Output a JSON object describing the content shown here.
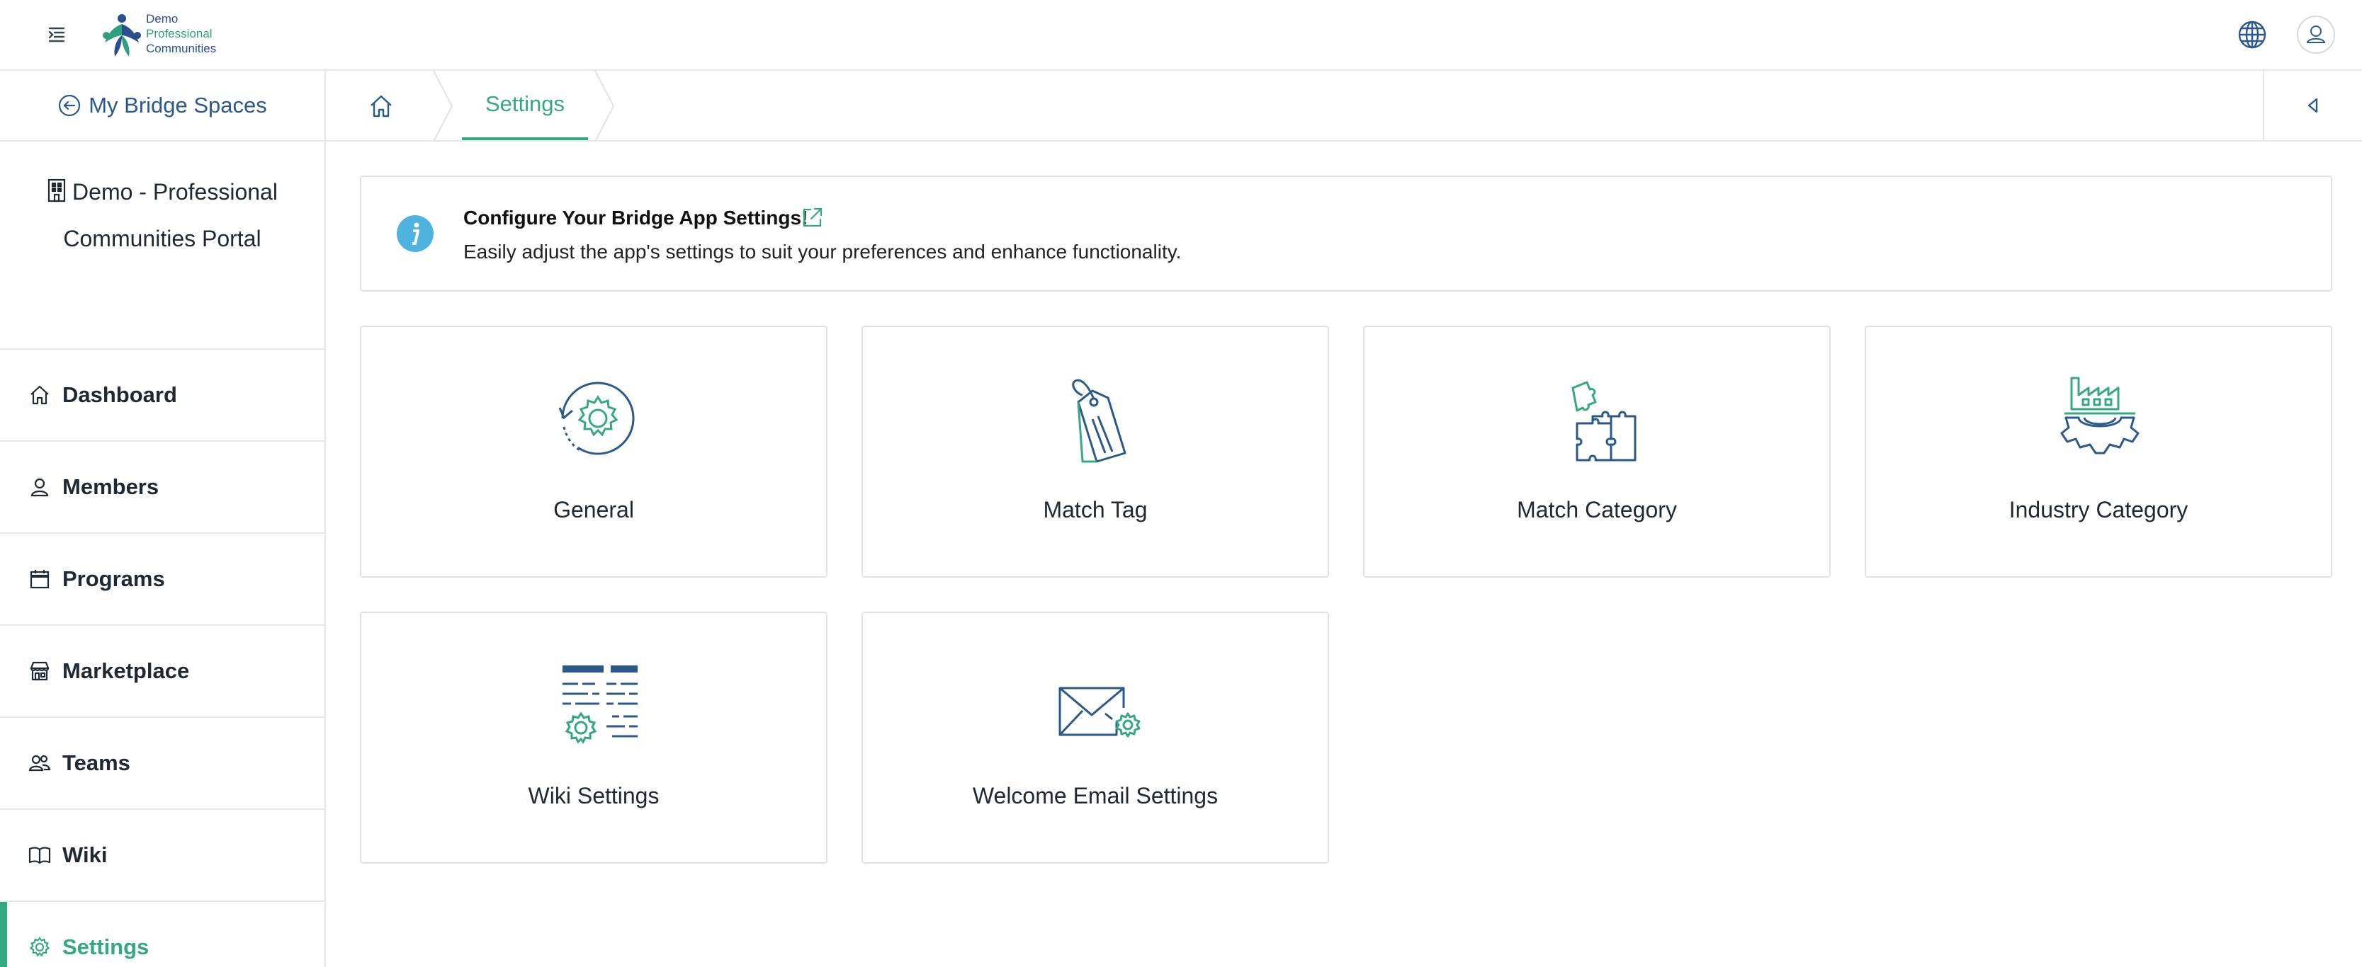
{
  "header": {
    "logo": {
      "line1": "Demo",
      "line2": "Professional",
      "line3": "Communities"
    }
  },
  "sidebar": {
    "back_label": "My Bridge Spaces",
    "portal_line1": "Demo - Professional",
    "portal_line2": "Communities Portal",
    "items": [
      {
        "label": "Dashboard",
        "icon": "home-icon"
      },
      {
        "label": "Members",
        "icon": "user-icon"
      },
      {
        "label": "Programs",
        "icon": "calendar-icon"
      },
      {
        "label": "Marketplace",
        "icon": "store-icon"
      },
      {
        "label": "Teams",
        "icon": "team-icon"
      },
      {
        "label": "Wiki",
        "icon": "book-icon"
      },
      {
        "label": "Settings",
        "icon": "gear-icon"
      }
    ]
  },
  "breadcrumb": {
    "current": "Settings"
  },
  "banner": {
    "title": "Configure Your Bridge App Settings!",
    "description": "Easily adjust the app's settings to suit your preferences and enhance functionality."
  },
  "cards": [
    {
      "label": "General",
      "icon": "general-settings-icon"
    },
    {
      "label": "Match Tag",
      "icon": "tag-icon"
    },
    {
      "label": "Match Category",
      "icon": "puzzle-icon"
    },
    {
      "label": "Industry Category",
      "icon": "industry-gear-icon"
    },
    {
      "label": "Wiki Settings",
      "icon": "wiki-settings-icon"
    },
    {
      "label": "Welcome Email Settings",
      "icon": "email-settings-icon"
    }
  ],
  "colors": {
    "accent": "#35a883",
    "primary": "#2b5a8a",
    "info": "#4fb3df"
  }
}
